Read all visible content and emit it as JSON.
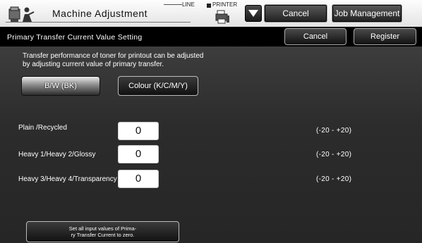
{
  "header": {
    "title": "Machine Adjustment",
    "line_label": "LINE",
    "printer_label": "PRINTER",
    "cancel_label": "Cancel",
    "job_management_label": "Job Management"
  },
  "subheader": {
    "page_title": "Primary Transfer Current Value Setting",
    "cancel_label": "Cancel",
    "register_label": "Register"
  },
  "description": {
    "line1": "Transfer performance of toner for printout can be adjusted",
    "line2": "by adjusting current value of primary transfer."
  },
  "modes": {
    "bw_label": "B/W (BK)",
    "colour_label": "Colour (K/C/M/Y)",
    "selected": "B/W (BK)"
  },
  "rows": [
    {
      "label": "Plain /Recycled",
      "value": "0",
      "range": "(-20 - +20)"
    },
    {
      "label": "Heavy 1/Heavy 2/Glossy",
      "value": "0",
      "range": "(-20 - +20)"
    },
    {
      "label": "Heavy 3/Heavy 4/Transparency",
      "value": "0",
      "range": "(-20 - +20)"
    }
  ],
  "zero_button": {
    "line1": "Set all input values of Prima-",
    "line2": "ry Transfer Current to zero."
  },
  "icons": {
    "app": "machine-adjustment-icon",
    "printer": "printer-icon",
    "dropdown": "triangle-down-icon"
  },
  "colors": {
    "header_bg": "#efefef",
    "main_bg": "#2e2e2e",
    "input_bg": "#ffffff"
  }
}
